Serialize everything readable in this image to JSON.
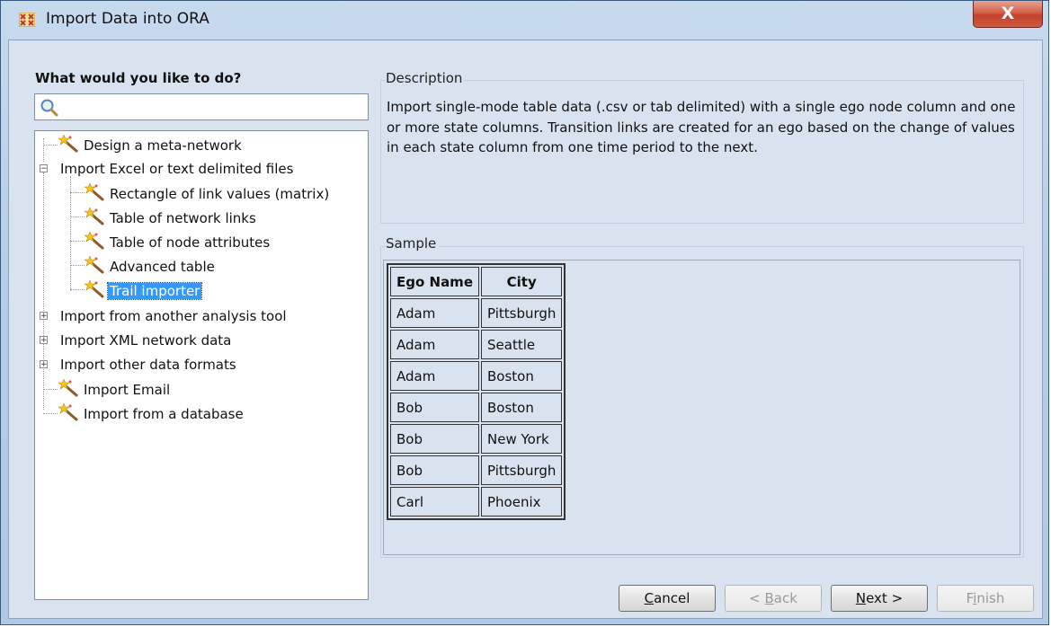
{
  "window": {
    "title": "Import Data into ORA",
    "close_label": "X"
  },
  "left": {
    "heading": "What would you like to do?",
    "search_placeholder": ""
  },
  "tree": {
    "items": [
      {
        "label": "Design a meta-network",
        "type": "leaf"
      },
      {
        "label": "Import Excel or text delimited files",
        "type": "expanded"
      },
      {
        "label": "Rectangle of link values (matrix)",
        "type": "leaf"
      },
      {
        "label": "Table of network links",
        "type": "leaf"
      },
      {
        "label": "Table of node attributes",
        "type": "leaf"
      },
      {
        "label": "Advanced table",
        "type": "leaf"
      },
      {
        "label": "Trail importer",
        "type": "leaf",
        "selected": true
      },
      {
        "label": "Import from another analysis tool",
        "type": "collapsed"
      },
      {
        "label": "Import XML network data",
        "type": "collapsed"
      },
      {
        "label": "Import other data formats",
        "type": "collapsed"
      },
      {
        "label": "Import Email",
        "type": "leaf"
      },
      {
        "label": "Import from a database",
        "type": "leaf"
      }
    ]
  },
  "description": {
    "title": "Description",
    "text": "Import single-mode table data (.csv or tab delimited) with a single ego node column and one or more state columns. Transition links are created for an ego based on the change of values in each state column from one time period to the next."
  },
  "sample": {
    "title": "Sample",
    "headers": [
      "Ego Name",
      "City"
    ],
    "rows": [
      [
        "Adam",
        "Pittsburgh"
      ],
      [
        "Adam",
        "Seattle"
      ],
      [
        "Adam",
        "Boston"
      ],
      [
        "Bob",
        "Boston"
      ],
      [
        "Bob",
        "New York"
      ],
      [
        "Bob",
        "Pittsburgh"
      ],
      [
        "Carl",
        "Phoenix"
      ]
    ]
  },
  "buttons": {
    "cancel": {
      "mnemonic": "C",
      "rest": "ancel"
    },
    "back": {
      "pre": "< ",
      "mnemonic": "B",
      "rest": "ack"
    },
    "next": {
      "mnemonic": "N",
      "rest": "ext >"
    },
    "finish": {
      "pre": "F",
      "mnemonic": "i",
      "rest": "nish"
    }
  },
  "colors": {
    "selection": "#3399ff",
    "close_button": "#c2412b",
    "dialog_background": "#d9e3ef"
  }
}
